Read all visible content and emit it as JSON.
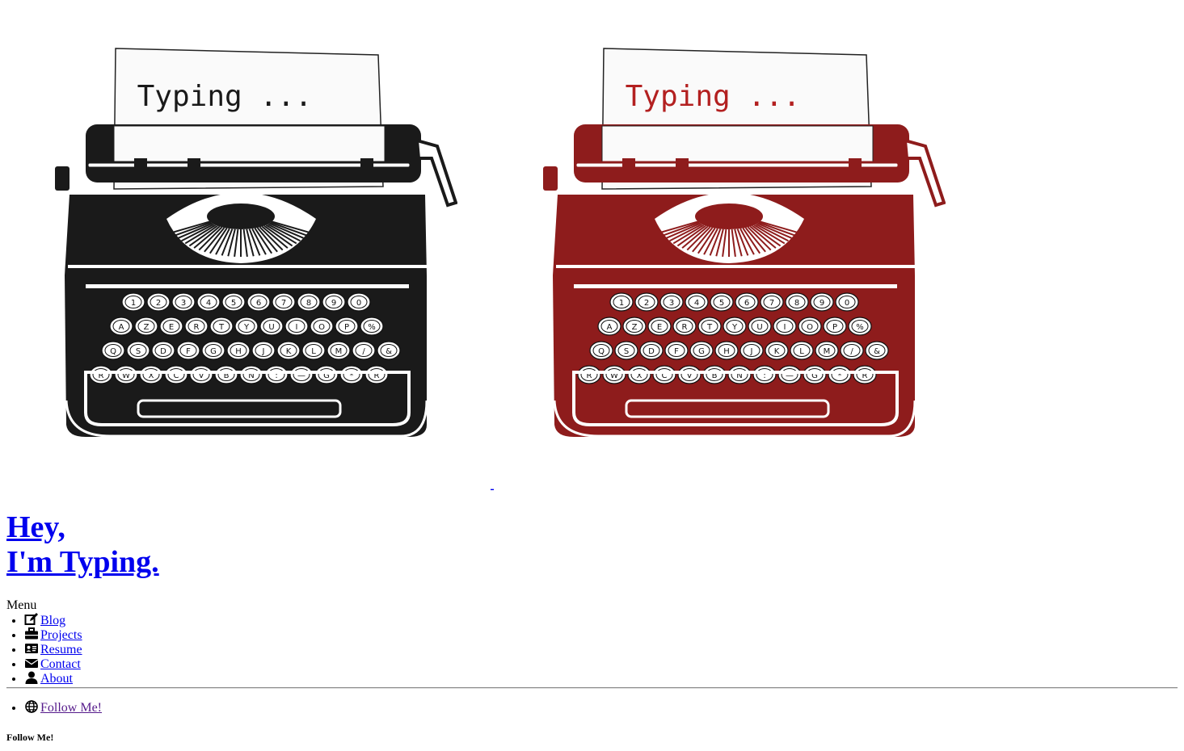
{
  "hero": {
    "typewriters": [
      {
        "paper_text": "Typing ...",
        "body_color": "#1a1a1a",
        "text_color": "#1a1a1a",
        "paper_color": "#fafafa"
      },
      {
        "paper_text": "Typing ...",
        "body_color": "#8e1c1c",
        "text_color": "#b32020",
        "paper_color": "#fafafa"
      }
    ],
    "key_rows": [
      [
        "1",
        "2",
        "3",
        "4",
        "5",
        "6",
        "7",
        "8",
        "9",
        "0"
      ],
      [
        "A",
        "Z",
        "E",
        "R",
        "T",
        "Y",
        "U",
        "I",
        "O",
        "P",
        "%"
      ],
      [
        "Q",
        "S",
        "D",
        "F",
        "G",
        "H",
        "J",
        "K",
        "L",
        "M",
        "/",
        "&"
      ],
      [
        "R",
        "W",
        "X",
        "C",
        "V",
        "B",
        "N",
        ":",
        "—",
        "G",
        "*",
        "R"
      ]
    ]
  },
  "site": {
    "title_line1": "Hey,",
    "title_line2": "I'm Typing."
  },
  "menu": {
    "label": "Menu",
    "items": [
      {
        "label": "Blog",
        "icon": "edit-icon"
      },
      {
        "label": "Projects",
        "icon": "briefcase-icon"
      },
      {
        "label": "Resume",
        "icon": "id-card-icon"
      },
      {
        "label": "Contact",
        "icon": "envelope-icon"
      },
      {
        "label": "About",
        "icon": "user-icon"
      }
    ]
  },
  "social": {
    "items": [
      {
        "label": "Follow Me!",
        "icon": "globe-icon"
      }
    ],
    "heading": "Follow Me!"
  },
  "colors": {
    "link": "#0000ee",
    "visited_link": "#551a8b"
  }
}
